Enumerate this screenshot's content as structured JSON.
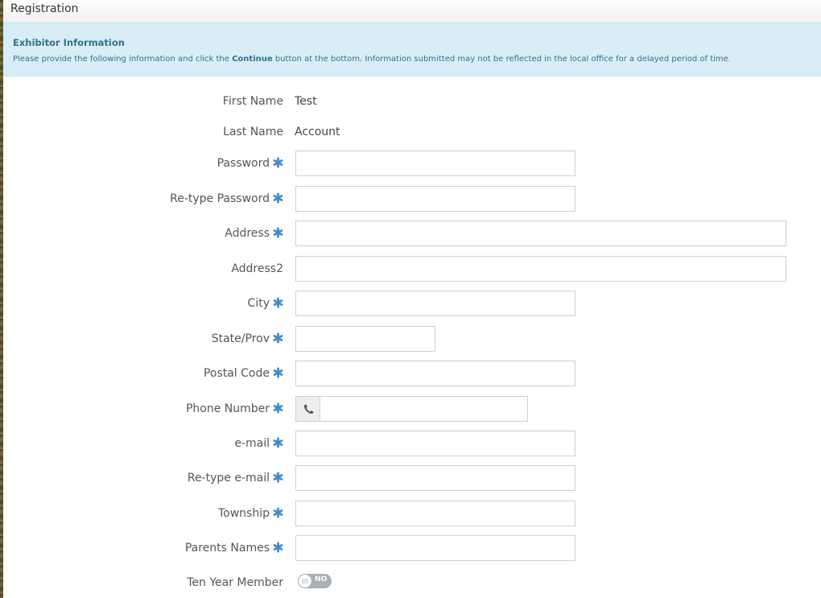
{
  "window": {
    "title": "Registration"
  },
  "alert": {
    "heading": "Exhibitor Information",
    "text_before": "Please provide the following information and click the ",
    "text_bold": "Continue",
    "text_after": " button at the bottom. Information submitted may not be reflected in the local office for a delayed period of time."
  },
  "form": {
    "first_name": {
      "label": "First Name",
      "value": "Test"
    },
    "last_name": {
      "label": "Last Name",
      "value": "Account"
    },
    "password": {
      "label": "Password",
      "value": "",
      "required": true
    },
    "retype_password": {
      "label": "Re-type Password",
      "value": "",
      "required": true
    },
    "address": {
      "label": "Address",
      "value": "",
      "required": true
    },
    "address2": {
      "label": "Address2",
      "value": ""
    },
    "city": {
      "label": "City",
      "value": "",
      "required": true
    },
    "state": {
      "label": "State/Prov",
      "value": "",
      "required": true
    },
    "postal": {
      "label": "Postal Code",
      "value": "",
      "required": true
    },
    "phone": {
      "label": "Phone Number",
      "value": "",
      "required": true,
      "icon": "phone-icon"
    },
    "email": {
      "label": "e-mail",
      "value": "",
      "required": true
    },
    "retype_email": {
      "label": "Re-type e-mail",
      "value": "",
      "required": true
    },
    "township": {
      "label": "Township",
      "value": "",
      "required": true
    },
    "parents": {
      "label": "Parents Names",
      "value": "",
      "required": true
    },
    "ten_year": {
      "label": "Ten Year Member",
      "toggle": "NO"
    }
  },
  "colors": {
    "required_icon": "#428bca",
    "alert_bg": "#d9edf7",
    "alert_text": "#31708f"
  }
}
